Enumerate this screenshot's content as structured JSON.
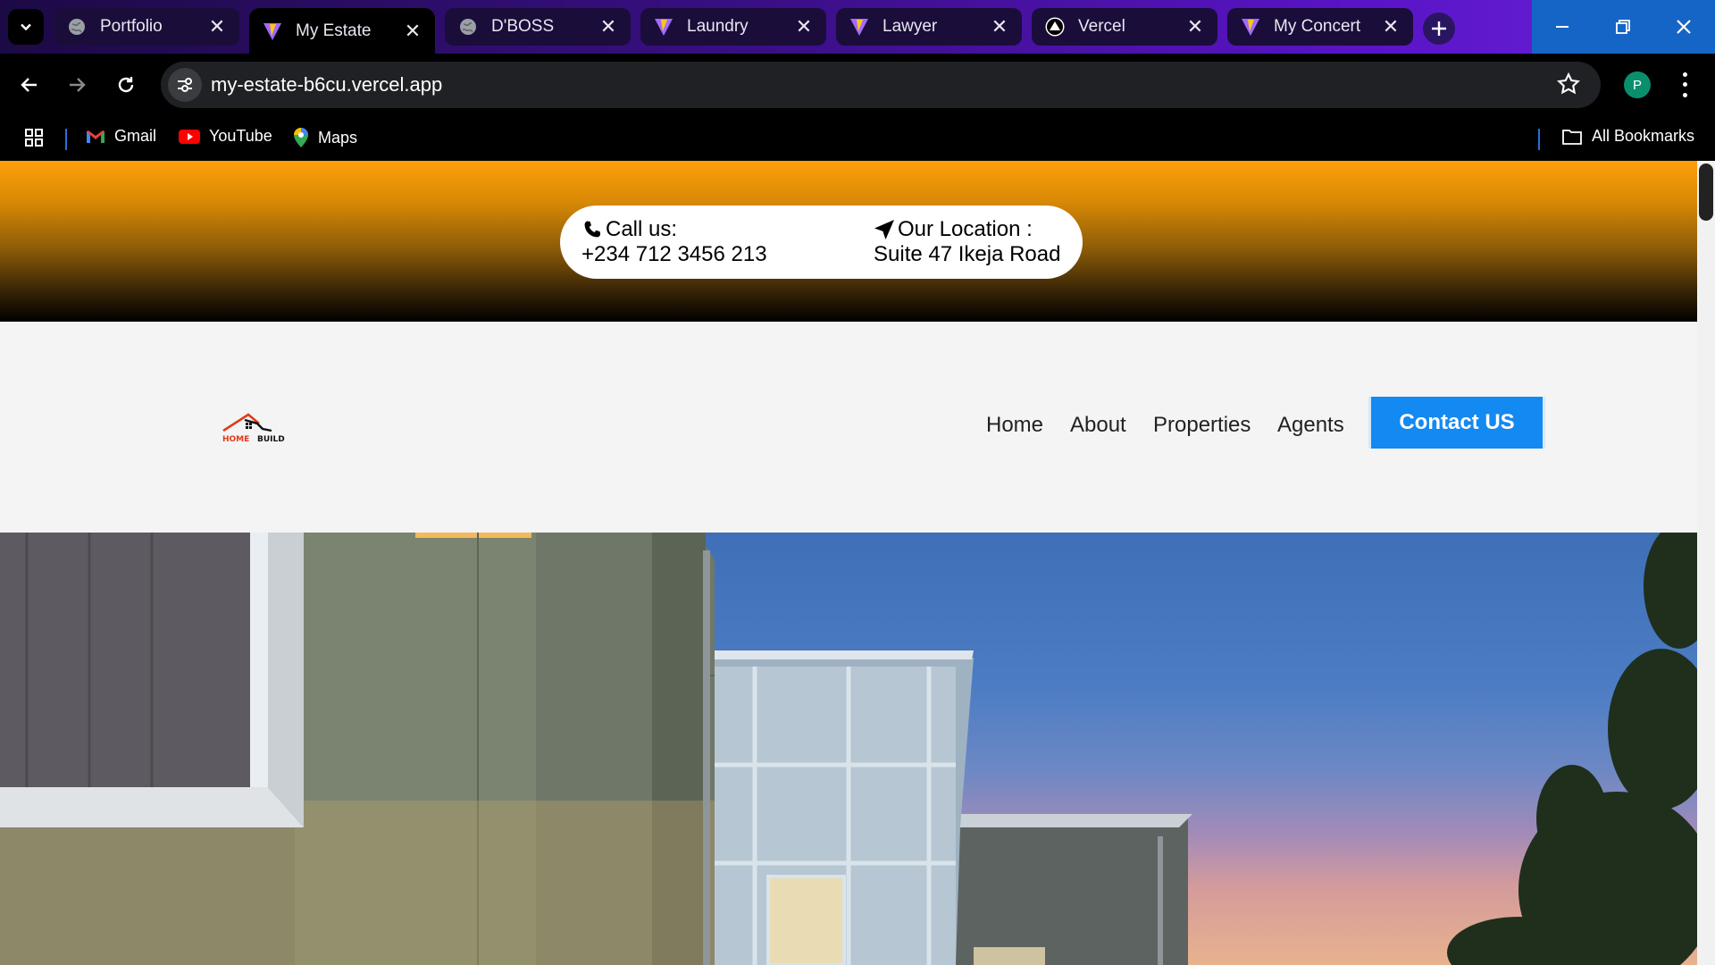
{
  "browser": {
    "tabs": [
      {
        "label": "Portfolio",
        "icon": "globe-icon",
        "active": false
      },
      {
        "label": "My Estate",
        "icon": "vite-icon",
        "active": true
      },
      {
        "label": "D'BOSS",
        "icon": "globe-icon",
        "active": false
      },
      {
        "label": "Laundry",
        "icon": "vite-icon",
        "active": false
      },
      {
        "label": "Lawyer",
        "icon": "vite-icon",
        "active": false
      },
      {
        "label": "Vercel",
        "icon": "vercel-icon",
        "active": false
      },
      {
        "label": "My Concert",
        "icon": "vite-icon",
        "active": false
      }
    ],
    "url": "my-estate-b6cu.vercel.app",
    "profile_initial": "P",
    "bookmarks": [
      {
        "label": "Gmail",
        "icon": "gmail-icon"
      },
      {
        "label": "YouTube",
        "icon": "youtube-icon"
      },
      {
        "label": "Maps",
        "icon": "maps-icon"
      }
    ],
    "all_bookmarks_label": "All Bookmarks",
    "accent_color": "#5a14c8",
    "window_controls_color": "#1565c7"
  },
  "site": {
    "topbar": {
      "call_label": "Call us:",
      "call_number": "+234 712 3456 213",
      "location_label": "Our Location :",
      "location_value": "Suite 47 Ikeja Road",
      "gradient_top": "#ff9f0a"
    },
    "logo": {
      "part1": "HOME",
      "part2": "BUILD"
    },
    "nav": {
      "home": "Home",
      "about": "About",
      "properties": "Properties",
      "agents": "Agents",
      "contact": "Contact US"
    },
    "contact_button_color": "#1389f2"
  }
}
